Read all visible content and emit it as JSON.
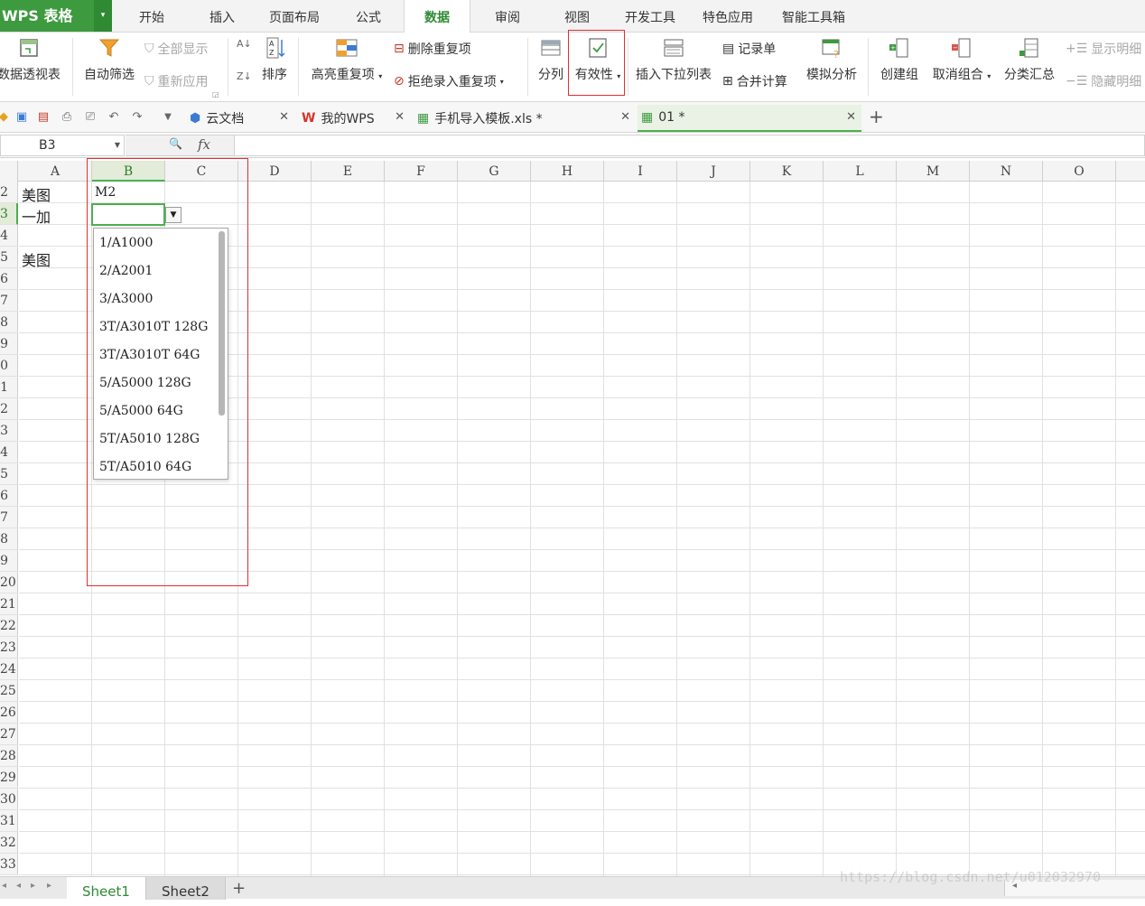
{
  "app": {
    "logo_text": "WPS 表格",
    "drop_arrow": "▾"
  },
  "menu": {
    "tabs": [
      "开始",
      "插入",
      "页面布局",
      "公式",
      "数据",
      "审阅",
      "视图",
      "开发工具",
      "特色应用",
      "智能工具箱"
    ],
    "active": "数据"
  },
  "ribbon": {
    "pivot": "数据透视表",
    "autofilter": "自动筛选",
    "show_all": "全部显示",
    "reapply": "重新应用",
    "sort": "排序",
    "highlight_dup": "高亮重复项",
    "remove_dup": "删除重复项",
    "reject_dup": "拒绝录入重复项",
    "split": "分列",
    "validity": "有效性",
    "insert_dropdown": "插入下拉列表",
    "record_form": "记录单",
    "merge_calc": "合并计算",
    "simulate": "模拟分析",
    "create_group": "创建组",
    "ungroup": "取消组合",
    "subtotal": "分类汇总",
    "show_detail": "显示明细",
    "hide_detail": "隐藏明细"
  },
  "doc_tabs": [
    {
      "label": "云文档"
    },
    {
      "label": "我的WPS"
    },
    {
      "label": "手机导入模板.xls *"
    },
    {
      "label": "01 *"
    }
  ],
  "formula_bar": {
    "cell_ref": "B3",
    "fx": "fx",
    "zoom_icon": "🔍"
  },
  "columns": [
    "A",
    "B",
    "C",
    "D",
    "E",
    "F",
    "G",
    "H",
    "I",
    "J",
    "K",
    "L",
    "M",
    "N",
    "O"
  ],
  "rows": [
    "2",
    "3",
    "4",
    "5",
    "6",
    "7",
    "8",
    "9",
    "0",
    "1",
    "2",
    "3",
    "4",
    "5",
    "6",
    "7",
    "8",
    "9",
    "20",
    "21",
    "22",
    "23",
    "24",
    "25",
    "26",
    "27",
    "28",
    "29",
    "30",
    "31",
    "32",
    "33"
  ],
  "cells": {
    "A2": "美图",
    "B2": "M2",
    "A3": "一加",
    "A5": "美图"
  },
  "dropdown_items": [
    "1/A1000",
    "2/A2001",
    "3/A3000",
    "3T/A3010T 128G",
    "3T/A3010T 64G",
    "5/A5000 128G",
    "5/A5000 64G",
    "5T/A5010 128G",
    "5T/A5010 64G"
  ],
  "sheets": [
    "Sheet1",
    "Sheet2"
  ],
  "active_sheet": "Sheet1",
  "add_sheet": "+",
  "add_tab": "+",
  "watermark": "https://blog.csdn.net/u012032970",
  "colors": {
    "accent": "#3d9a3f",
    "highlight_frame": "#e03030",
    "selection": "#4caf50"
  }
}
